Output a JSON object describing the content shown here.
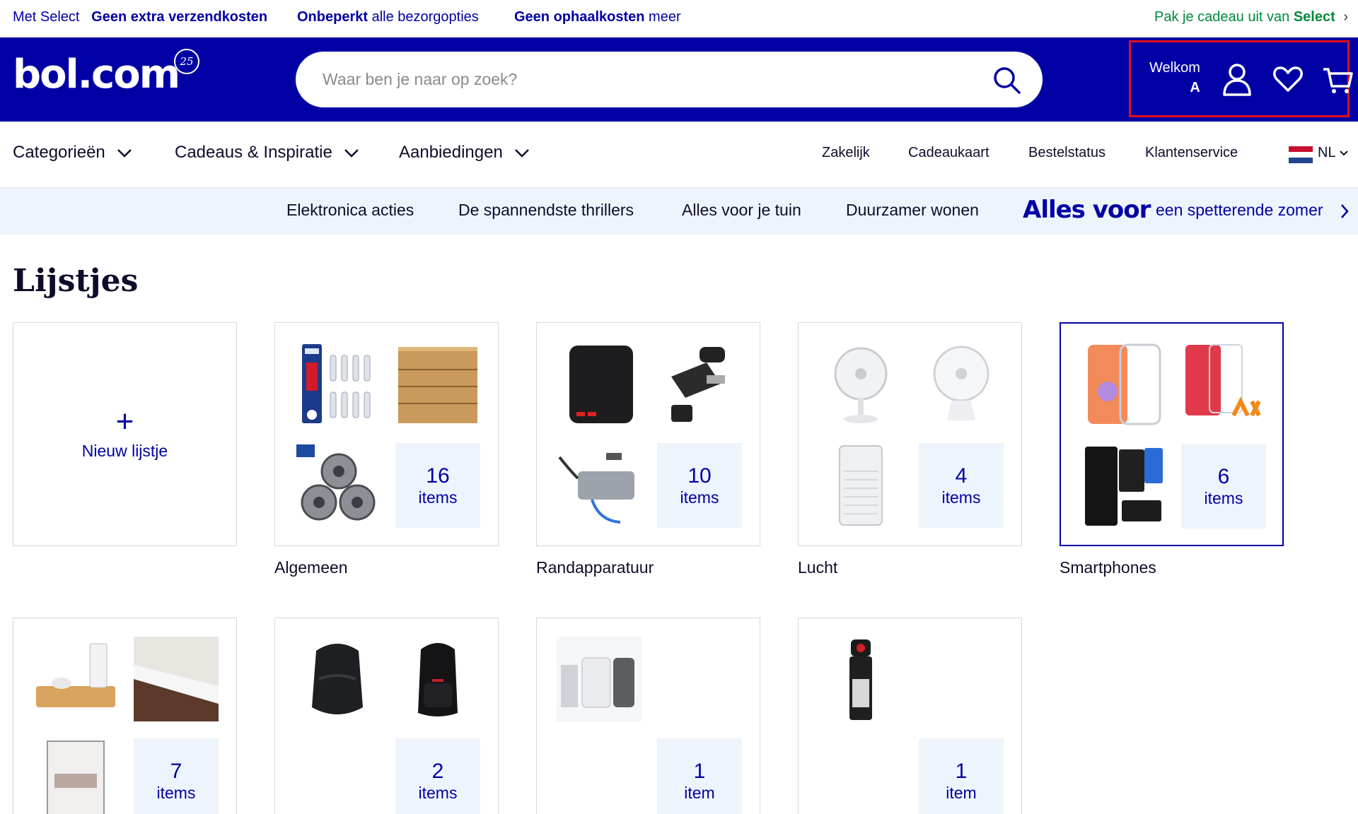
{
  "promo_bar": {
    "items": [
      {
        "prefix": "Met Select",
        "bold": "Geen extra verzendkosten",
        "suffix": ""
      },
      {
        "prefix": "",
        "bold": "Onbeperkt",
        "suffix": " alle bezorgopties"
      },
      {
        "prefix": "",
        "bold": "Geen ophaalkosten",
        "suffix": " meer"
      }
    ],
    "right_prefix": "Pak je cadeau uit van ",
    "right_bold": "Select",
    "right_arrow": "›"
  },
  "header": {
    "logo_text": "bol.com",
    "logo_badge": "25",
    "search_placeholder": "Waar ben je naar op zoek?",
    "welcome": "Welkom",
    "user_initial": "A"
  },
  "nav": {
    "categories": [
      "Categorieën",
      "Cadeaus & Inspiratie",
      "Aanbiedingen"
    ],
    "links": [
      "Zakelijk",
      "Cadeaukaart",
      "Bestelstatus",
      "Klantenservice"
    ],
    "language": "NL"
  },
  "highlights": {
    "items": [
      "Elektronica acties",
      "De spannendste thrillers",
      "Alles voor je tuin",
      "Duurzamer wonen"
    ],
    "promo_big": "Alles voor",
    "promo_small": "een spetterende zomer"
  },
  "page": {
    "title": "Lijstjes",
    "new_list_plus": "+",
    "new_list_label": "Nieuw lijstje",
    "lists": [
      {
        "name": "Algemeen",
        "count": "16",
        "unit": "items"
      },
      {
        "name": "Randapparatuur",
        "count": "10",
        "unit": "items"
      },
      {
        "name": "Lucht",
        "count": "4",
        "unit": "items"
      },
      {
        "name": "Smartphones",
        "count": "6",
        "unit": "items"
      },
      {
        "name": "",
        "count": "7",
        "unit": "items"
      },
      {
        "name": "",
        "count": "2",
        "unit": "items"
      },
      {
        "name": "",
        "count": "1",
        "unit": "item"
      },
      {
        "name": "",
        "count": "1",
        "unit": "item"
      }
    ]
  },
  "colors": {
    "brand_blue": "#0000a4",
    "select_green": "#008a3c",
    "highlight_bg": "#eef4fc",
    "focus_red": "#e0101a"
  }
}
